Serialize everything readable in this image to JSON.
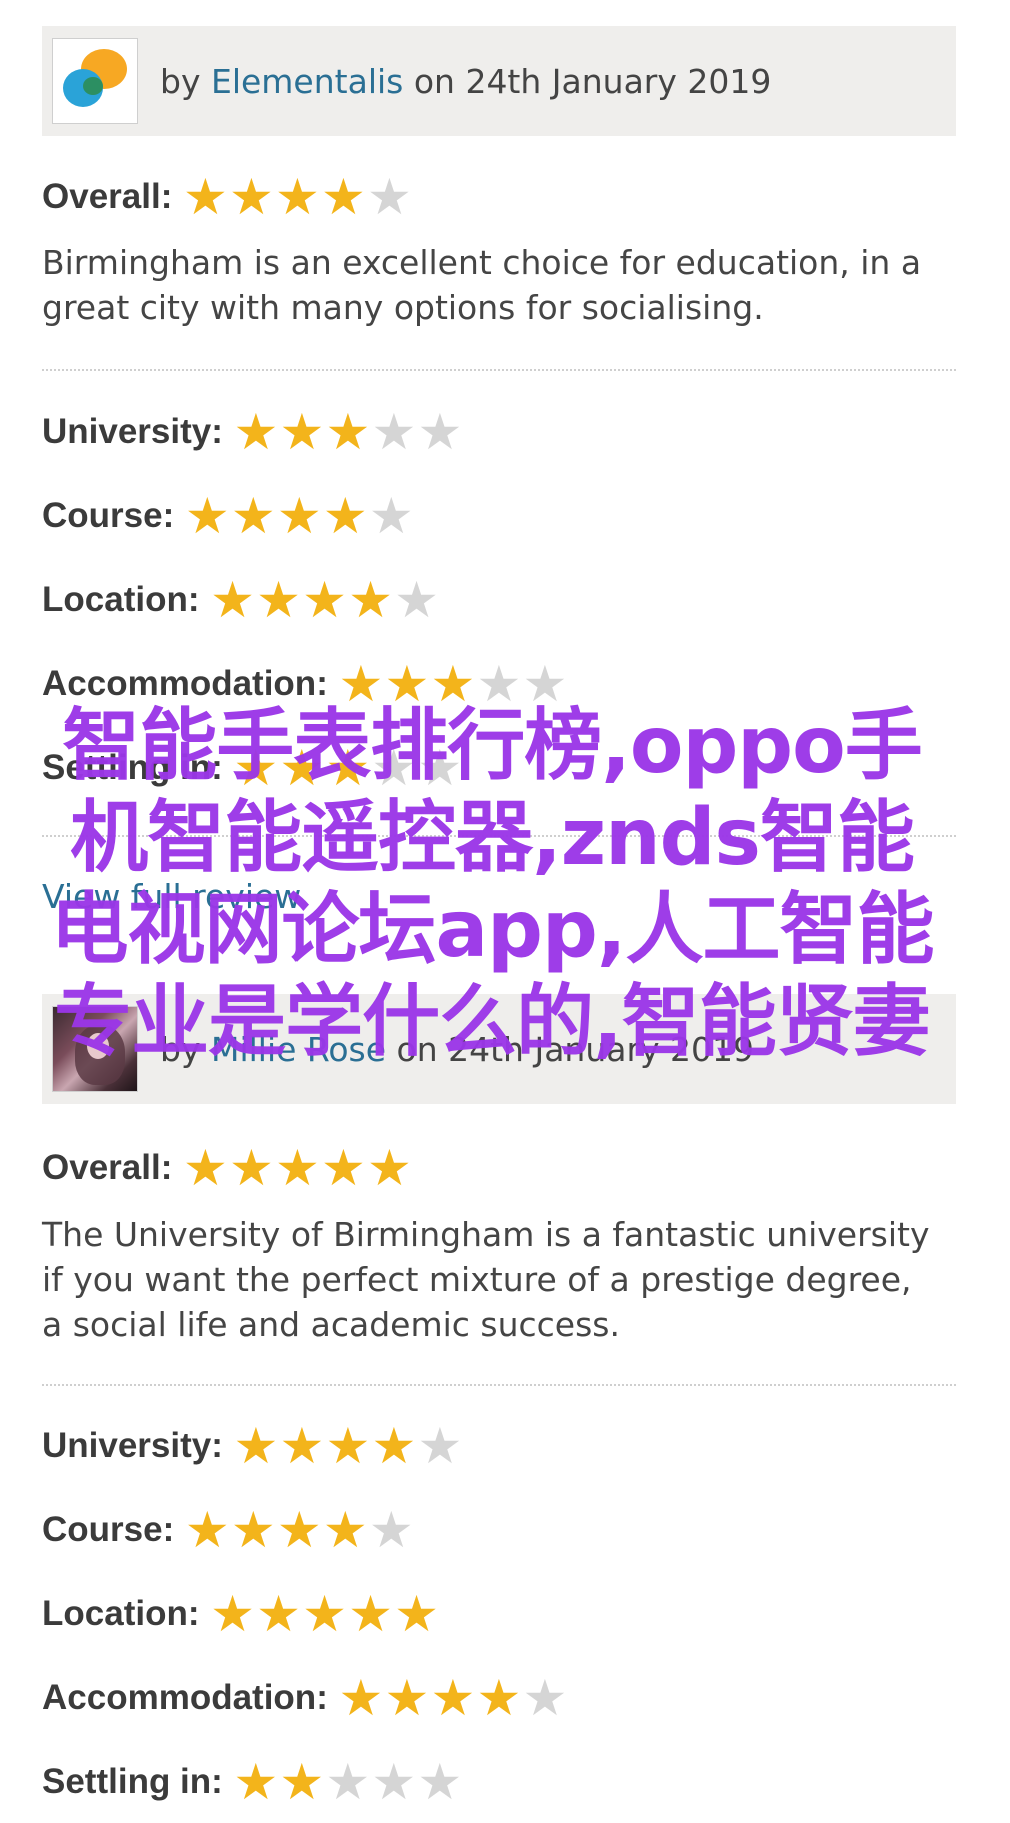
{
  "colors": {
    "star_on": "#f3b41b",
    "star_off": "#d5d5d5",
    "author_link": "#2a6f94",
    "overlay_text": "#9b36e8",
    "header_bg": "#efeeec"
  },
  "reviews": [
    {
      "by_prefix": "by ",
      "author": "Elementalis",
      "date_text": " on 24th January 2019",
      "avatar_icon": "elementalis-logo-avatar",
      "overall_label": "Overall:",
      "overall_rating": 4,
      "comment": "Birmingham is an excellent choice for education, in a great city with many options for socialising.",
      "categories": [
        {
          "label": "University:",
          "rating": 3
        },
        {
          "label": "Course:",
          "rating": 4
        },
        {
          "label": "Location:",
          "rating": 4
        },
        {
          "label": "Accommodation:",
          "rating": 3
        },
        {
          "label": "Settling in:",
          "rating": 3
        }
      ],
      "link_text": "View full review"
    },
    {
      "by_prefix": "by ",
      "author": "Millie Rose",
      "date_text": " on 24th January 2019",
      "avatar_icon": "user-photo-avatar",
      "overall_label": "Overall:",
      "overall_rating": 5,
      "comment": "The University of Birmingham is a fantastic university if you want the perfect mixture of a prestige degree, a social life and academic success.",
      "categories": [
        {
          "label": "University:",
          "rating": 4
        },
        {
          "label": "Course:",
          "rating": 4
        },
        {
          "label": "Location:",
          "rating": 5
        },
        {
          "label": "Accommodation:",
          "rating": 4
        },
        {
          "label": "Settling in:",
          "rating": 2
        }
      ]
    }
  ],
  "star_max": 5,
  "overlay_text": "智能手表排行榜,oppo手机智能遥控器,znds智能电视网论坛app,人工智能专业是学什么的,智能贤妻"
}
